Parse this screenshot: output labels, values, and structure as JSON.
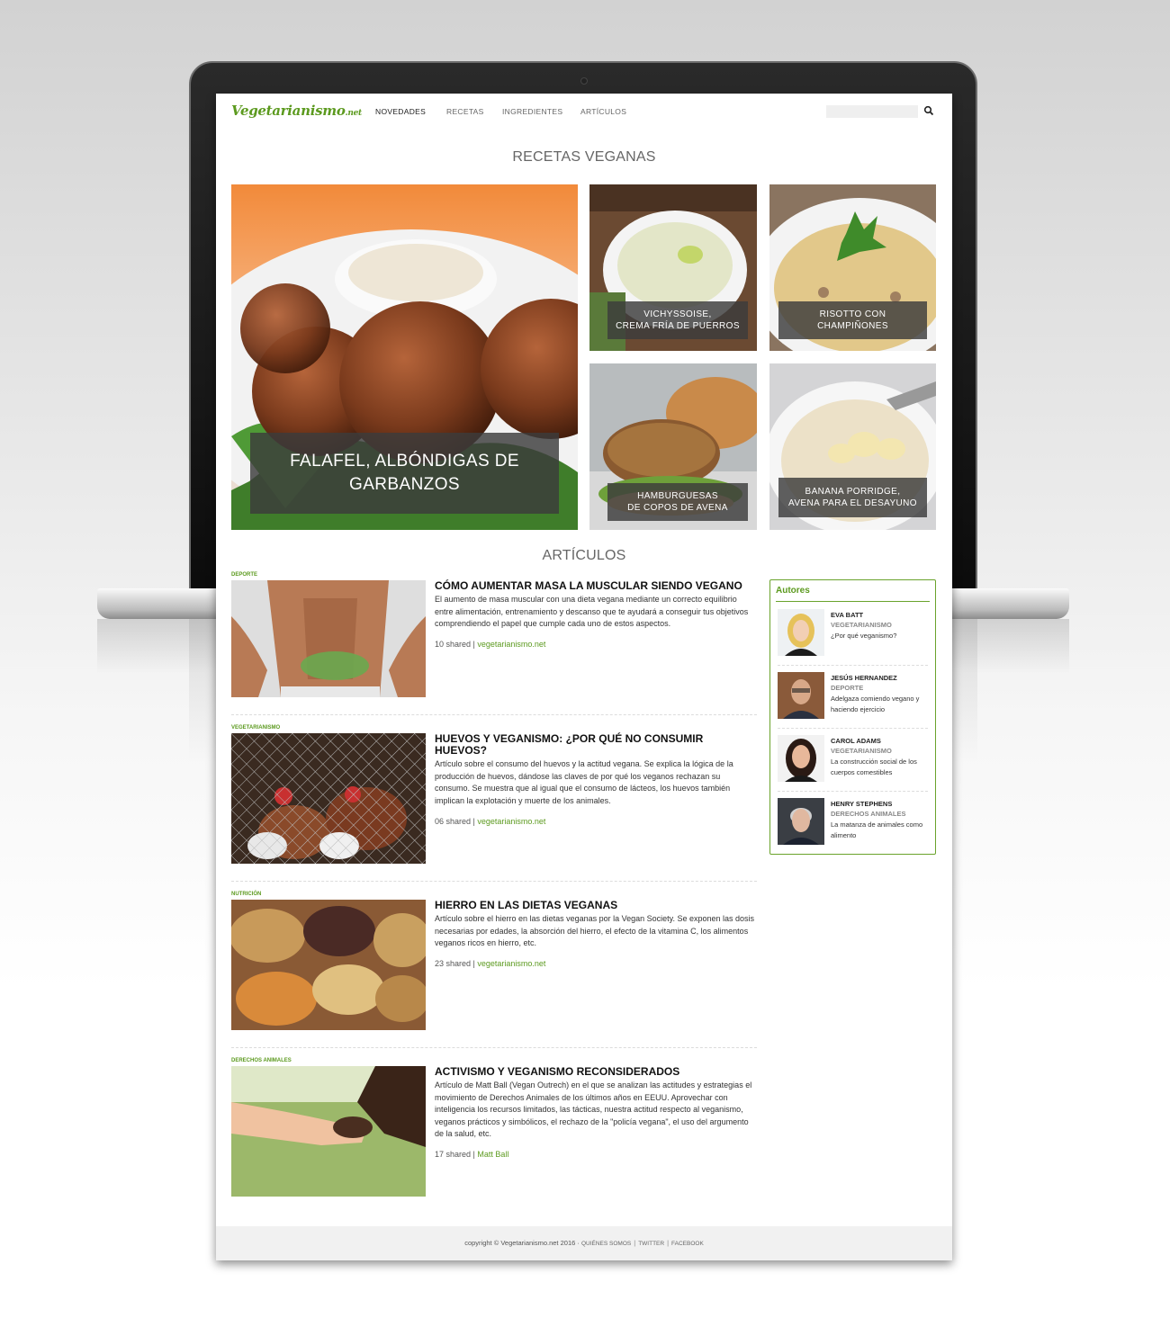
{
  "site": {
    "logo_main": "Vegetarianismo",
    "logo_suffix": ".net"
  },
  "nav": {
    "items": [
      {
        "label": "NOVEDADES",
        "active": true
      },
      {
        "label": "RECETAS",
        "active": false
      },
      {
        "label": "INGREDIENTES",
        "active": false
      },
      {
        "label": "ARTÍCULOS",
        "active": false
      }
    ]
  },
  "search": {
    "placeholder": "",
    "icon": "search-icon"
  },
  "recipes": {
    "section_title": "RECETAS VEGANAS",
    "featured": {
      "caption": "FALAFEL, ALBÓNDIGAS DE\nGARBANZOS"
    },
    "items": [
      {
        "caption": "VICHYSSOISE,\nCREMA FRÍA DE PUERROS"
      },
      {
        "caption": "RISOTTO CON\nCHAMPIÑONES"
      },
      {
        "caption": "HAMBURGUESAS\nDE COPOS DE AVENA"
      },
      {
        "caption": "BANANA PORRIDGE,\nAVENA PARA EL DESAYUNO"
      }
    ]
  },
  "articles": {
    "section_title": "ARTÍCULOS",
    "items": [
      {
        "category": "DEPORTE",
        "title": "CÓMO AUMENTAR MASA LA MUSCULAR SIENDO VEGANO",
        "description": "El aumento de masa muscular con una dieta vegana mediante un correcto equilibrio entre alimentación, entrenamiento y descanso que te ayudará a conseguir tus objetivos comprendiendo el papel que cumple cada uno de estos aspectos.",
        "shared": "10 shared",
        "source": "vegetarianismo.net"
      },
      {
        "category": "VEGETARIANISMO",
        "title": "HUEVOS Y VEGANISMO: ¿POR QUÉ NO CONSUMIR HUEVOS?",
        "description": "Artículo sobre el consumo del huevos y la actitud vegana. Se explica la lógica de la producción de huevos, dándose las claves de por qué los veganos rechazan su consumo. Se muestra que al igual que el consumo de lácteos, los huevos también implican la explotación y muerte de los animales.",
        "shared": "06 shared",
        "source": "vegetarianismo.net"
      },
      {
        "category": "NUTRICIÓN",
        "title": "HIERRO EN LAS DIETAS VEGANAS",
        "description": "Artículo sobre el hierro en las dietas veganas por la Vegan Society. Se exponen las dosis necesarias por edades, la absorción del hierro, el efecto de la vitamina C, los alimentos veganos ricos en hierro, etc.",
        "shared": "23 shared",
        "source": "vegetarianismo.net"
      },
      {
        "category": "DERECHOS ANIMALES",
        "title": "ACTIVISMO Y VEGANISMO RECONSIDERADOS",
        "description": "Artículo de Matt Ball (Vegan Outrech) en el que se analizan las actitudes y estrategias el movimiento de Derechos Animales de los últimos años en EEUU. Aprovechar con inteligencia los recursos limitados, las tácticas, nuestra actitud respecto al veganismo, veganos prácticos y simbólicos, el rechazo de la \"policía vegana\", el uso del argumento de la salud, etc.",
        "shared": "17 shared",
        "source": "Matt Ball"
      }
    ]
  },
  "authors": {
    "title": "Autores",
    "items": [
      {
        "name": "EVA BATT",
        "category": "VEGETARIANISMO",
        "topic": "¿Por qué veganismo?"
      },
      {
        "name": "JESÚS HERNANDEZ",
        "category": "DEPORTE",
        "topic": "Adelgaza comiendo vegano y haciendo ejercicio"
      },
      {
        "name": "CAROL ADAMS",
        "category": "VEGETARIANISMO",
        "topic": "La construcción social de los cuerpos comestibles"
      },
      {
        "name": "HENRY STEPHENS",
        "category": "DERECHOS ANIMALES",
        "topic": "La matanza de animales como alimento"
      }
    ]
  },
  "footer": {
    "copyright": "copyright © Vegetarianismo.net 2016 ·",
    "links": [
      "QUIÉNES SOMOS",
      "TWITTER",
      "FACEBOOK"
    ],
    "separator": "|"
  },
  "colors": {
    "accent": "#5c9a1f",
    "caption_bg": "#3c3c3c",
    "footer_bg": "#f1f1f1"
  }
}
